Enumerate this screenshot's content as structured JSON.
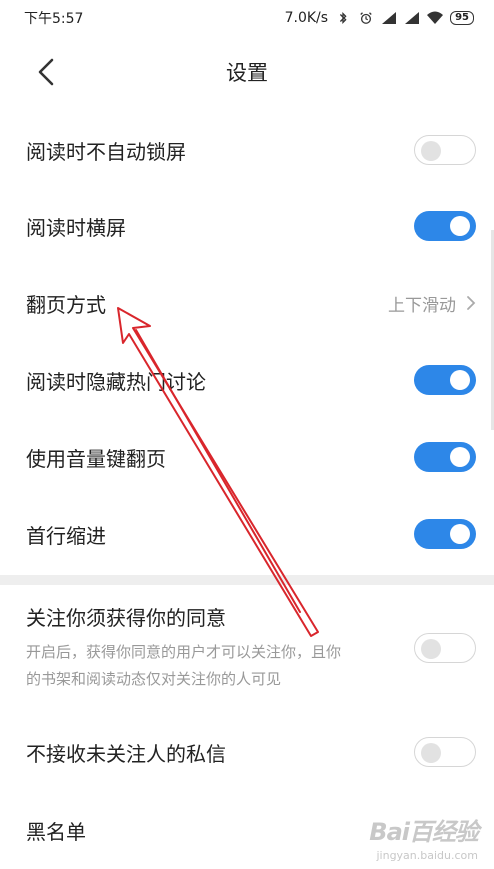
{
  "status_bar": {
    "time": "下午5:57",
    "speed": "7.0K/s",
    "battery": "95"
  },
  "header": {
    "title": "设置"
  },
  "settings": [
    {
      "label": "阅读时不自动锁屏",
      "control": "switch",
      "state": "off"
    },
    {
      "label": "阅读时横屏",
      "control": "switch",
      "state": "on"
    },
    {
      "label": "翻页方式",
      "control": "value",
      "value": "上下滑动"
    },
    {
      "label": "阅读时隐藏热门讨论",
      "control": "switch",
      "state": "on"
    },
    {
      "label": "使用音量键翻页",
      "control": "switch",
      "state": "on"
    },
    {
      "label": "首行缩进",
      "control": "switch",
      "state": "on"
    }
  ],
  "privacy": {
    "follow_consent": {
      "title": "关注你须获得你的同意",
      "desc_line1": "开启后，获得你同意的用户才可以关注你，且你",
      "desc_line2": "的书架和阅读动态仅对关注你的人可见",
      "state": "off"
    },
    "no_strangers_msg": {
      "label": "不接收未关注人的私信",
      "state": "off"
    },
    "blacklist": {
      "label": "黑名单"
    }
  },
  "watermark": {
    "logo_text": "Bai百经验",
    "sub_text": "jingyan.baidu.com"
  },
  "colors": {
    "accent": "#2d87e8",
    "annotation_arrow": "#d9262c"
  }
}
